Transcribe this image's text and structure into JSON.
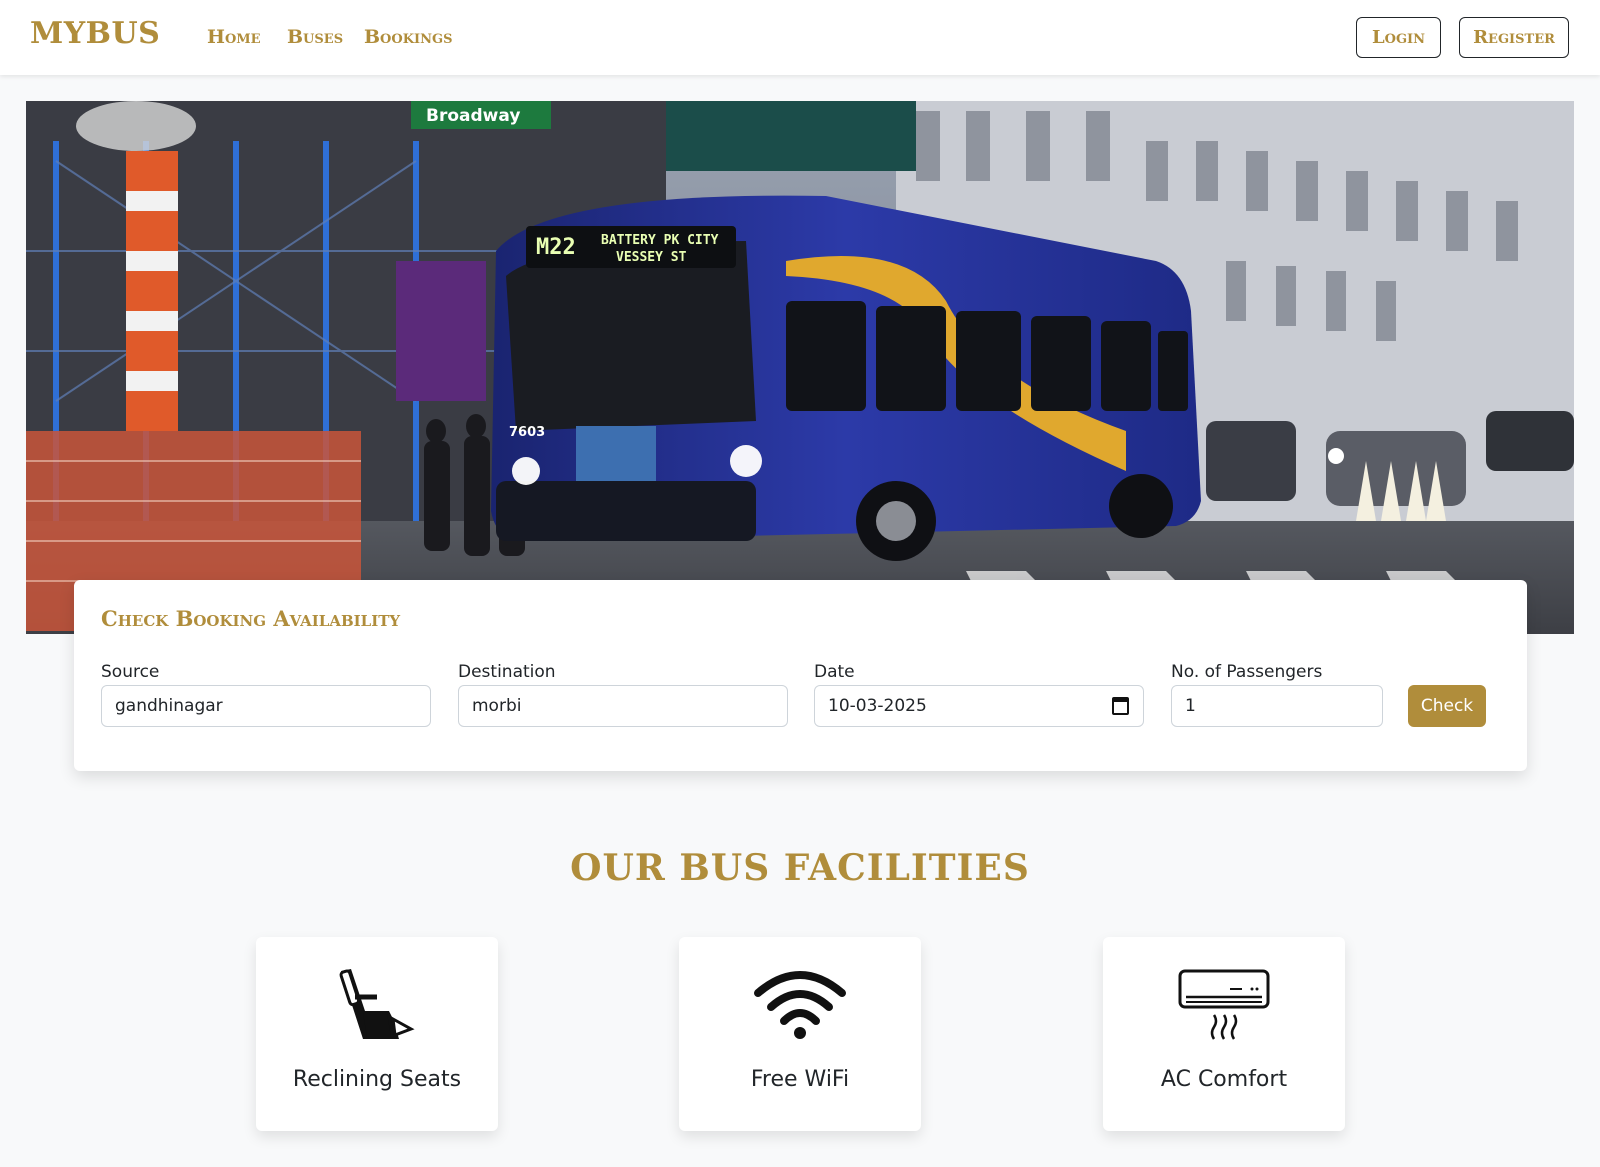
{
  "navbar": {
    "brand": "MYBUS",
    "links": [
      "Home",
      "Buses",
      "Bookings"
    ],
    "login_label": "Login",
    "register_label": "Register"
  },
  "hero": {
    "image": "city bus on street",
    "street_sign": "Broadway",
    "bus_route": "M22",
    "bus_destination_line1": "BATTERY PK CITY",
    "bus_destination_line2": "VESSEY ST",
    "bus_number": "7603"
  },
  "booking": {
    "title": "Check Booking Availability",
    "source_label": "Source",
    "source_value": "gandhinagar",
    "destination_label": "Destination",
    "destination_value": "morbi",
    "date_label": "Date",
    "date_value": "10-03-2025",
    "passengers_label": "No. of Passengers",
    "passengers_value": "1",
    "check_label": "Check"
  },
  "facilities": {
    "title": "OUR BUS FACILITIES",
    "items": [
      {
        "label": "Reclining Seats",
        "icon": "reclining-seat-icon"
      },
      {
        "label": "Free WiFi",
        "icon": "wifi-icon"
      },
      {
        "label": "AC Comfort",
        "icon": "air-conditioner-icon"
      }
    ]
  },
  "colors": {
    "accent": "#b08d3b",
    "bus_body": "#1f2a8a",
    "bus_stripe": "#e0a82e"
  }
}
